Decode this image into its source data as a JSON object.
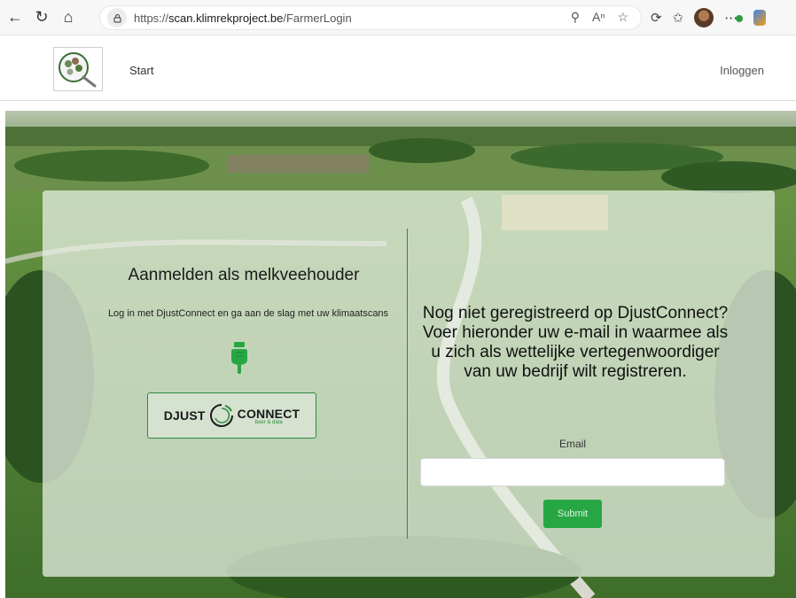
{
  "browser": {
    "url_prefix": "https://",
    "url_host": "scan.klimrekproject.be",
    "url_path": "/FarmerLogin"
  },
  "nav": {
    "start_label": "Start",
    "login_label": "Inloggen"
  },
  "left": {
    "title": "Aanmelden als melkveehouder",
    "subtitle": "Log in met DjustConnect en ga aan de slag met uw klimaatscans",
    "button_brand_left": "DJUST",
    "button_brand_right": "CONNECT",
    "button_tagline": "boer & data"
  },
  "right": {
    "title": "Nog niet geregistreerd op DjustConnect? Voer hieronder uw e-mail in waarmee als u zich als wettelijke vertegenwoordiger van uw bedrijf wilt registreren.",
    "email_label": "Email",
    "email_value": "",
    "submit_label": "Submit"
  },
  "colors": {
    "accent_green": "#27a744",
    "divider_green": "#2e8b3e"
  },
  "icons": [
    "back-icon",
    "refresh-icon",
    "home-icon",
    "lock-icon",
    "zoom-icon",
    "read-aloud-icon",
    "favorite-icon",
    "extensions-icon",
    "collections-icon",
    "profile-icon",
    "more-icon",
    "copilot-icon",
    "hand-pointer-icon",
    "logo-icon"
  ]
}
